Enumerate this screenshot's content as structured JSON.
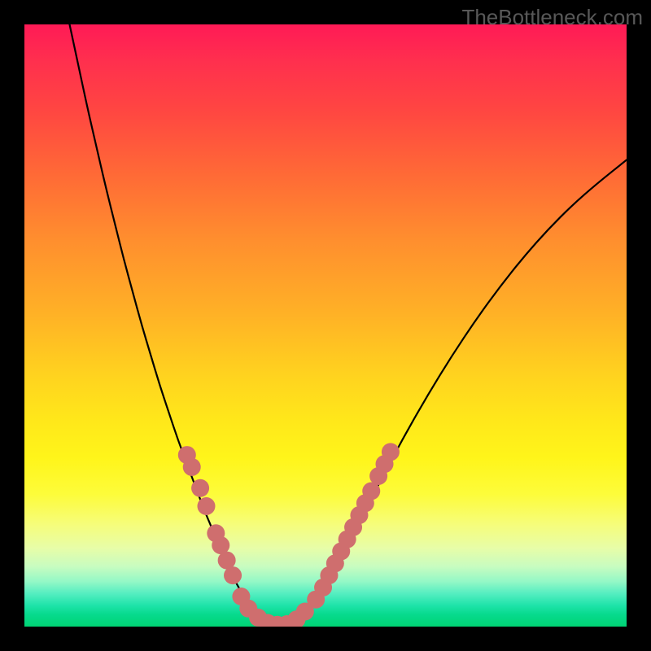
{
  "watermark": "TheBottleneck.com",
  "colors": {
    "background": "#000000",
    "curve": "#000000",
    "dots": "#cf6e6e",
    "gradient_top": "#ff1a56",
    "gradient_bottom": "#00d474"
  },
  "chart_data": {
    "type": "line",
    "title": "",
    "xlabel": "",
    "ylabel": "",
    "xlim": [
      0,
      100
    ],
    "ylim": [
      0,
      100
    ],
    "x": [
      7.5,
      9,
      10.5,
      12,
      13.5,
      15,
      16.5,
      18,
      19.5,
      21,
      22.5,
      24,
      25.5,
      27,
      28.5,
      30,
      31.5,
      33,
      35,
      37,
      39.5,
      42,
      44.5,
      47,
      49,
      51,
      55,
      59,
      63,
      67,
      71,
      75,
      79,
      83,
      87,
      91,
      95,
      100
    ],
    "y": [
      100,
      93,
      86,
      79.5,
      73,
      67,
      61,
      55.5,
      50,
      45,
      40,
      35.5,
      31,
      27,
      23,
      19,
      15.5,
      11.5,
      7.5,
      4,
      1.5,
      0.3,
      0.7,
      2.5,
      5,
      8.5,
      16,
      24,
      31.5,
      38.5,
      45,
      51,
      56.5,
      61.5,
      66,
      70,
      73.5,
      77.5
    ],
    "dots": [
      {
        "x": 27.0,
        "y": 28.5
      },
      {
        "x": 27.8,
        "y": 26.5
      },
      {
        "x": 29.2,
        "y": 23.0
      },
      {
        "x": 30.2,
        "y": 20.0
      },
      {
        "x": 31.8,
        "y": 15.5
      },
      {
        "x": 32.6,
        "y": 13.5
      },
      {
        "x": 33.6,
        "y": 11.0
      },
      {
        "x": 34.6,
        "y": 8.5
      },
      {
        "x": 36.0,
        "y": 5.0
      },
      {
        "x": 37.2,
        "y": 3.0
      },
      {
        "x": 38.8,
        "y": 1.5
      },
      {
        "x": 40.4,
        "y": 0.6
      },
      {
        "x": 42.0,
        "y": 0.3
      },
      {
        "x": 43.6,
        "y": 0.4
      },
      {
        "x": 45.2,
        "y": 1.2
      },
      {
        "x": 46.6,
        "y": 2.5
      },
      {
        "x": 48.4,
        "y": 4.5
      },
      {
        "x": 49.6,
        "y": 6.5
      },
      {
        "x": 50.6,
        "y": 8.5
      },
      {
        "x": 51.6,
        "y": 10.5
      },
      {
        "x": 52.6,
        "y": 12.5
      },
      {
        "x": 53.6,
        "y": 14.5
      },
      {
        "x": 54.6,
        "y": 16.5
      },
      {
        "x": 55.6,
        "y": 18.5
      },
      {
        "x": 56.6,
        "y": 20.5
      },
      {
        "x": 57.6,
        "y": 22.5
      },
      {
        "x": 58.8,
        "y": 25.0
      },
      {
        "x": 59.8,
        "y": 27.0
      },
      {
        "x": 60.8,
        "y": 29.0
      }
    ]
  }
}
